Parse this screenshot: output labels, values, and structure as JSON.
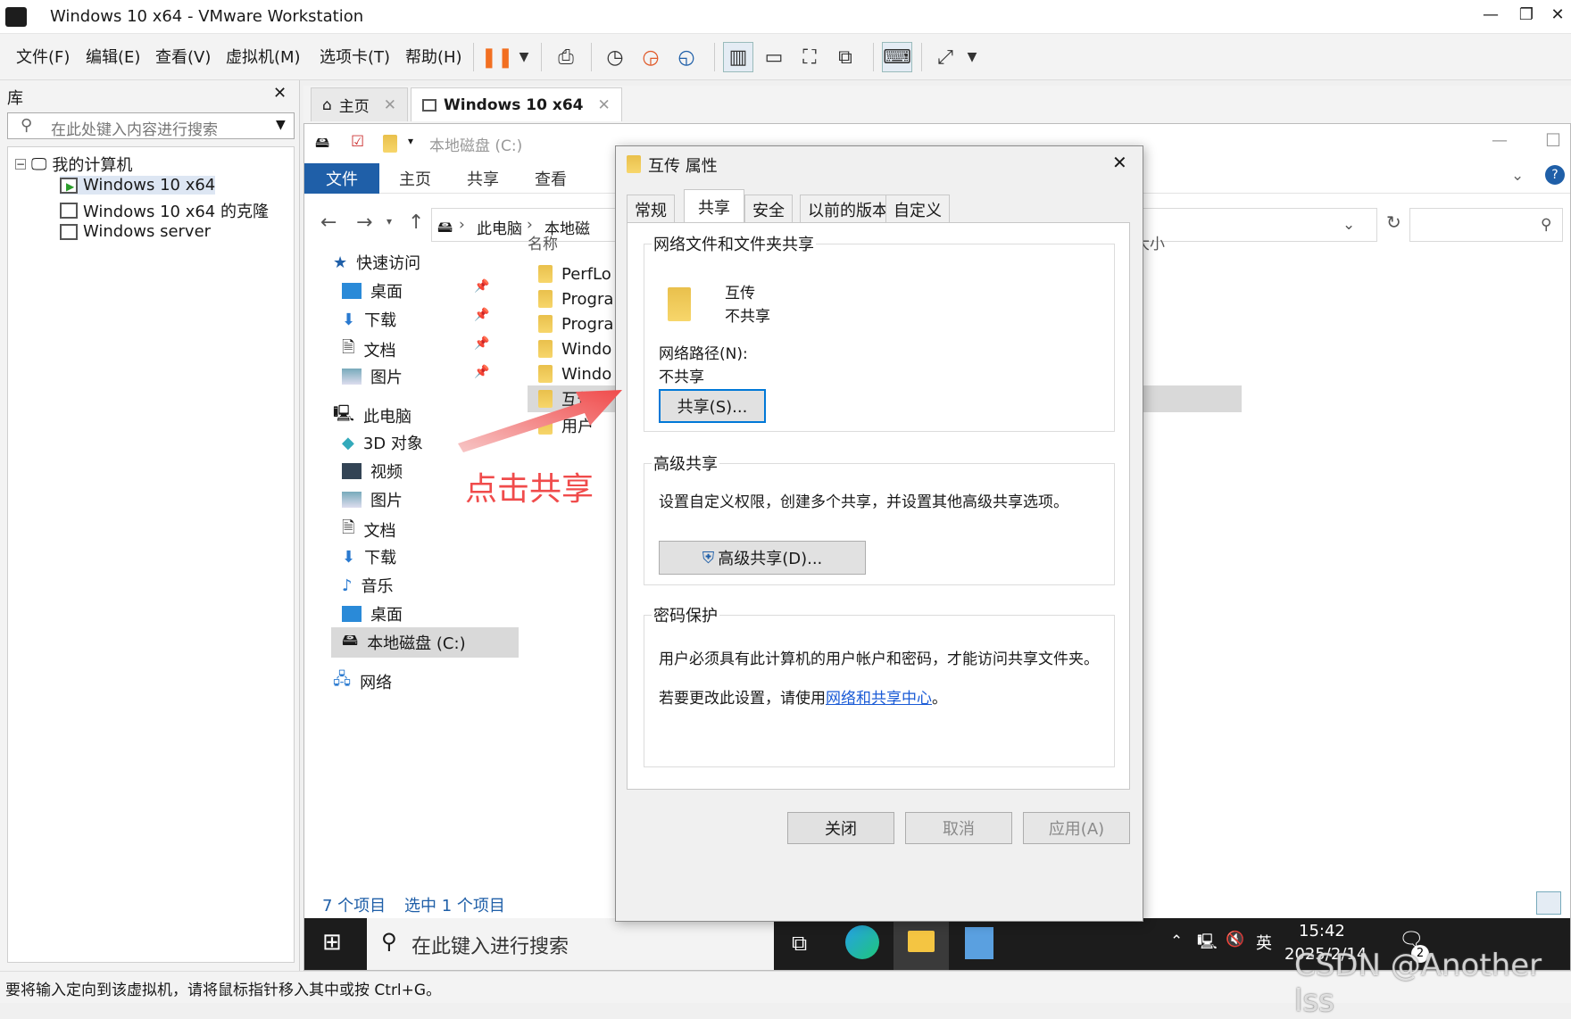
{
  "window": {
    "title": "Windows 10 x64 - VMware Workstation"
  },
  "menu": [
    "文件(F)",
    "编辑(E)",
    "查看(V)",
    "虚拟机(M)",
    "选项卡(T)",
    "帮助(H)"
  ],
  "library": {
    "title": "库",
    "search_placeholder": "在此处键入内容进行搜索",
    "root": "我的计算机",
    "items": [
      "Windows 10 x64",
      "Windows 10 x64 的克隆",
      "Windows server"
    ]
  },
  "tabs": [
    {
      "label": "主页"
    },
    {
      "label": "Windows 10 x64"
    }
  ],
  "explorer": {
    "title": "本地磁盘 (C:)",
    "ribbon_tabs": [
      "文件",
      "主页",
      "共享",
      "查看"
    ],
    "breadcrumb": [
      "此电脑",
      "本地磁"
    ],
    "column_name": "名称",
    "column_size": "大小",
    "nav": {
      "quick_access": "快速访问",
      "quick_items": [
        "桌面",
        "下载",
        "文档",
        "图片"
      ],
      "this_pc": "此电脑",
      "pc_items": [
        "3D 对象",
        "视频",
        "图片",
        "文档",
        "下载",
        "音乐",
        "桌面",
        "本地磁盘 (C:)"
      ],
      "network": "网络"
    },
    "files": [
      "PerfLo",
      "Progra",
      "Progra",
      "Windo",
      "Windo",
      "互传",
      "用户"
    ],
    "status_count": "7 个项目",
    "status_selected": "选中 1 个项目"
  },
  "taskbar": {
    "search": "在此键入进行搜索",
    "ime": "英",
    "time": "15:42",
    "date": "2025/2/14",
    "notifications": "2"
  },
  "dialog": {
    "title": "互传 属性",
    "tabs": [
      "常规",
      "共享",
      "安全",
      "以前的版本",
      "自定义"
    ],
    "active_tab": "共享",
    "net_group": {
      "legend": "网络文件和文件夹共享",
      "folder_name": "互传",
      "folder_state": "不共享",
      "path_label": "网络路径(N):",
      "path_value": "不共享",
      "share_button": "共享(S)..."
    },
    "adv_group": {
      "legend": "高级共享",
      "desc": "设置自定义权限，创建多个共享，并设置其他高级共享选项。",
      "button": "高级共享(D)..."
    },
    "pwd_group": {
      "legend": "密码保护",
      "desc": "用户必须具有此计算机的用户帐户和密码，才能访问共享文件夹。",
      "change_prefix": "若要更改此设置，请使用",
      "link": "网络和共享中心",
      "change_suffix": "。"
    },
    "buttons": {
      "close": "关闭",
      "cancel": "取消",
      "apply": "应用(A)"
    }
  },
  "annotation": "点击共享",
  "vm_status": "要将输入定向到该虚拟机，请将鼠标指针移入其中或按 Ctrl+G。",
  "watermark": "CSDN @Another lss",
  "colors": {
    "accent": "#1f5fa8",
    "annotation": "#f04b4b",
    "pause": "#f26f21"
  }
}
